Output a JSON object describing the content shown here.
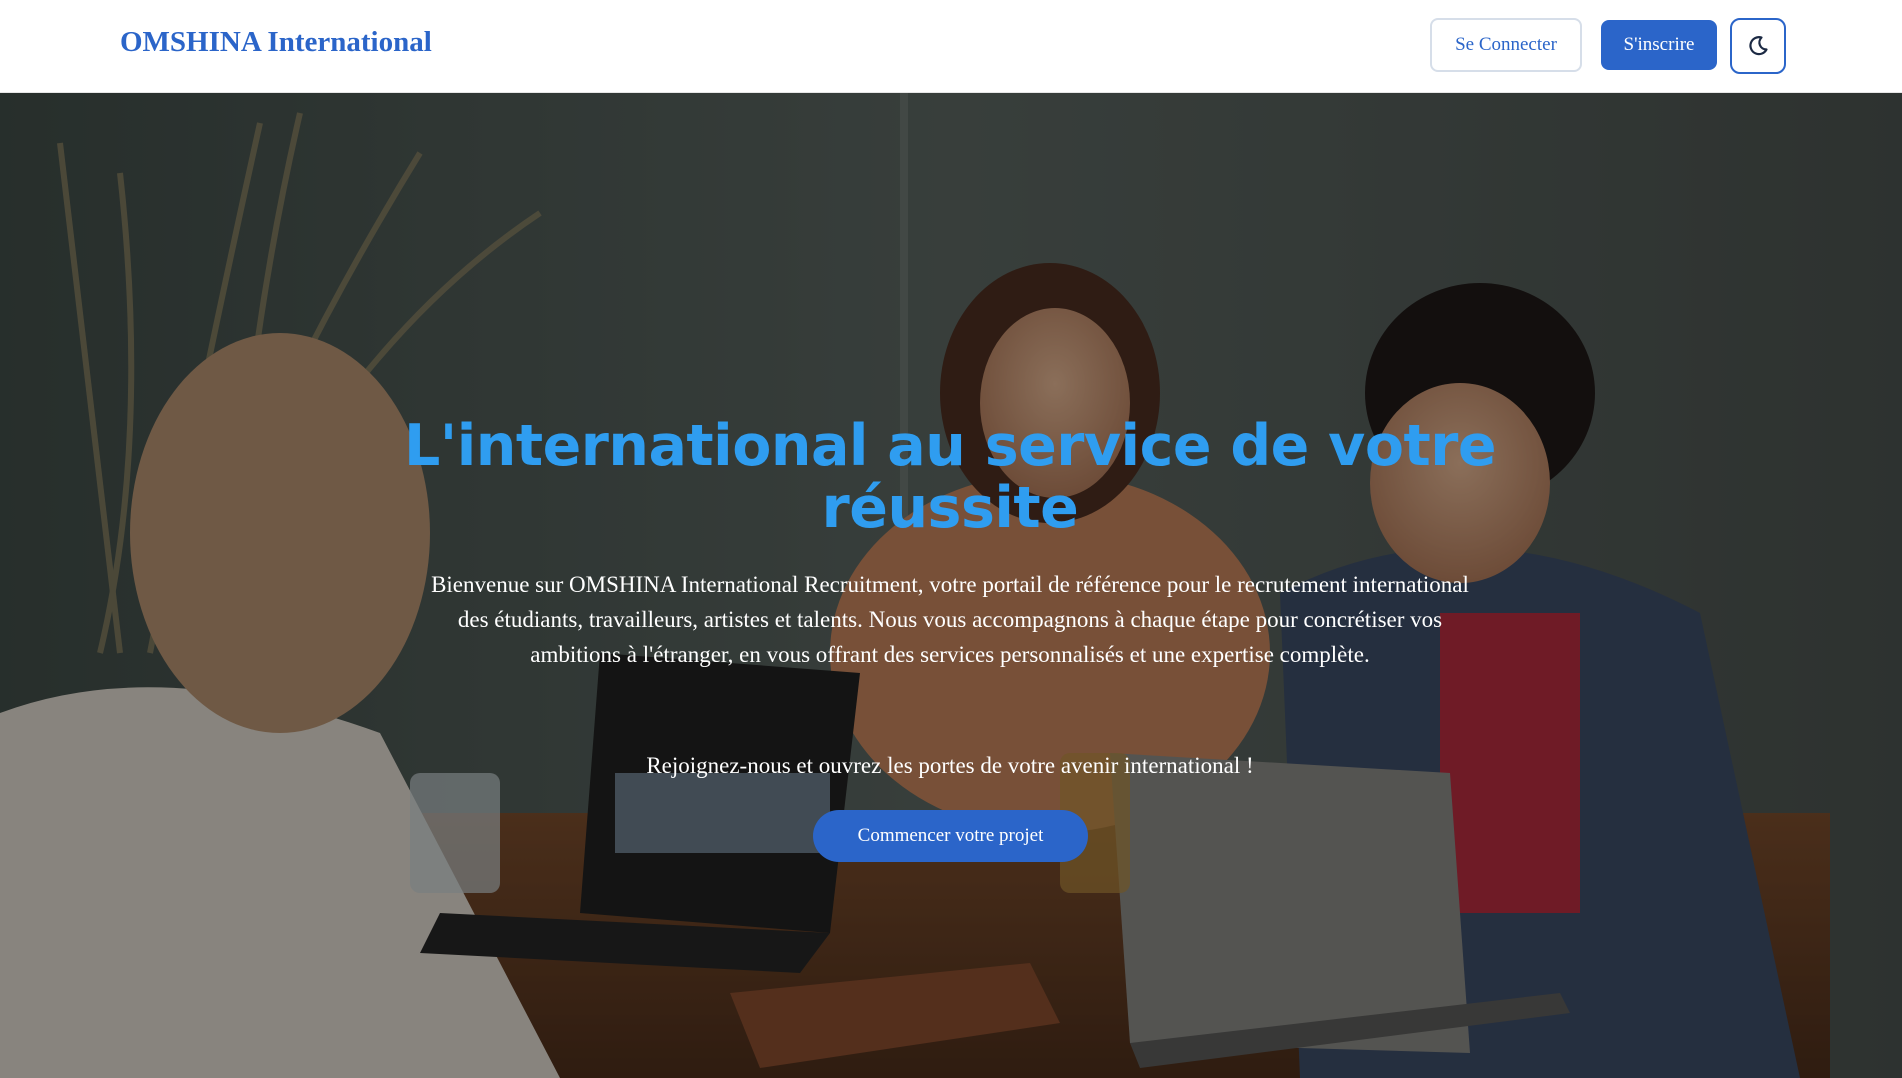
{
  "header": {
    "brand": "OMSHINA International",
    "login_label": "Se Connecter",
    "signup_label": "S'inscrire",
    "theme_toggle_icon": "moon-icon"
  },
  "hero": {
    "title": "L'international au service de votre réussite",
    "description": "Bienvenue sur OMSHINA International Recruitment, votre portail de référence pour le recrutement international des étudiants, travailleurs, artistes et talents. Nous vous accompagnons à chaque étape pour concrétiser vos ambitions à l'étranger, en vous offrant des services personnalisés et une expertise complète.",
    "join_text": "Rejoignez-nous et ouvrez les portes de votre avenir international !",
    "cta_label": "Commencer votre projet",
    "background_image": "three-people-laughing-with-laptops-at-cafe-table"
  },
  "colors": {
    "brand_blue": "#2b65c9",
    "title_blue": "#2f9df0",
    "white": "#ffffff"
  }
}
